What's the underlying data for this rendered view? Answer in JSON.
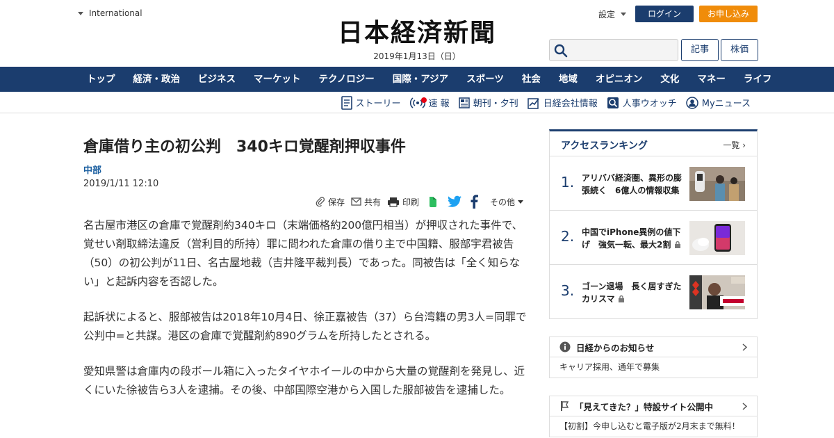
{
  "header": {
    "region": "International",
    "logo": "日本経済新聞",
    "date": "2019年1月13日（日）",
    "settings": "設定",
    "login": "ログイン",
    "apply": "お申し込み",
    "btn_articles": "記事",
    "btn_stocks": "株価",
    "search_icon": "search-icon"
  },
  "nav": [
    "トップ",
    "経済・政治",
    "ビジネス",
    "マーケット",
    "テクノロジー",
    "国際・アジア",
    "スポーツ",
    "社会",
    "地域",
    "オピニオン",
    "文化",
    "マネー",
    "ライフ"
  ],
  "subnav": [
    {
      "label": "ストーリー",
      "icon": "document-icon"
    },
    {
      "label": "速 報",
      "icon": "broadcast-icon"
    },
    {
      "label": "朝刊・夕刊",
      "icon": "newspaper-icon"
    },
    {
      "label": "日経会社情報",
      "icon": "chart-icon"
    },
    {
      "label": "人事ウオッチ",
      "icon": "person-search-icon"
    },
    {
      "label": "Myニュース",
      "icon": "user-icon"
    }
  ],
  "article": {
    "title": "倉庫借り主の初公判　340キロ覚醒剤押収事件",
    "location": "中部",
    "date": "2019/1/11 12:10",
    "tools": {
      "save": "保存",
      "share": "共有",
      "print": "印刷",
      "other": "その他"
    },
    "paragraphs": [
      "名古屋市港区の倉庫で覚醒剤約340キロ（末端価格約200億円相当）が押収された事件で、覚せい剤取締法違反（営利目的所持）罪に問われた倉庫の借り主で中国籍、服部宇君被告（50）の初公判が11日、名古屋地裁（吉井隆平裁判長）であった。同被告は「全く知らない」と起訴内容を否認した。",
      "起訴状によると、服部被告は2018年10月4日、徐正嘉被告（37）ら台湾籍の男3人=同罪で公判中=と共謀。港区の倉庫で覚醒剤約890グラムを所持したとされる。",
      "愛知県警は倉庫内の段ボール箱に入ったタイヤホイールの中から大量の覚醒剤を発見し、近くにいた徐被告ら3人を逮捕。その後、中部国際空港から入国した服部被告を逮捕した。"
    ]
  },
  "ranking": {
    "title": "アクセスランキング",
    "more": "一覧",
    "items": [
      {
        "rank": "1.",
        "text": "アリババ経済圏、異形の膨張続く　6億人の情報収集",
        "locked": false
      },
      {
        "rank": "2.",
        "text": "中国でiPhone異例の値下げ　強気一転、最大2割",
        "locked": true
      },
      {
        "rank": "3.",
        "text": "ゴーン退場　長く居すぎたカリスマ",
        "locked": true
      }
    ]
  },
  "notices": [
    {
      "title": "日経からのお知らせ",
      "body": "キャリア採用、通年で募集",
      "icon": "info-icon"
    },
    {
      "title": "「見えてきた？」特設サイト公開中",
      "body": "【初割】今申し込むと電子版が2月末まで無料！",
      "icon": "flag-icon"
    }
  ],
  "colors": {
    "brand": "#1b3d6e",
    "accent": "#f08c0a",
    "red": "#e60012",
    "link": "#1b5fa0"
  }
}
